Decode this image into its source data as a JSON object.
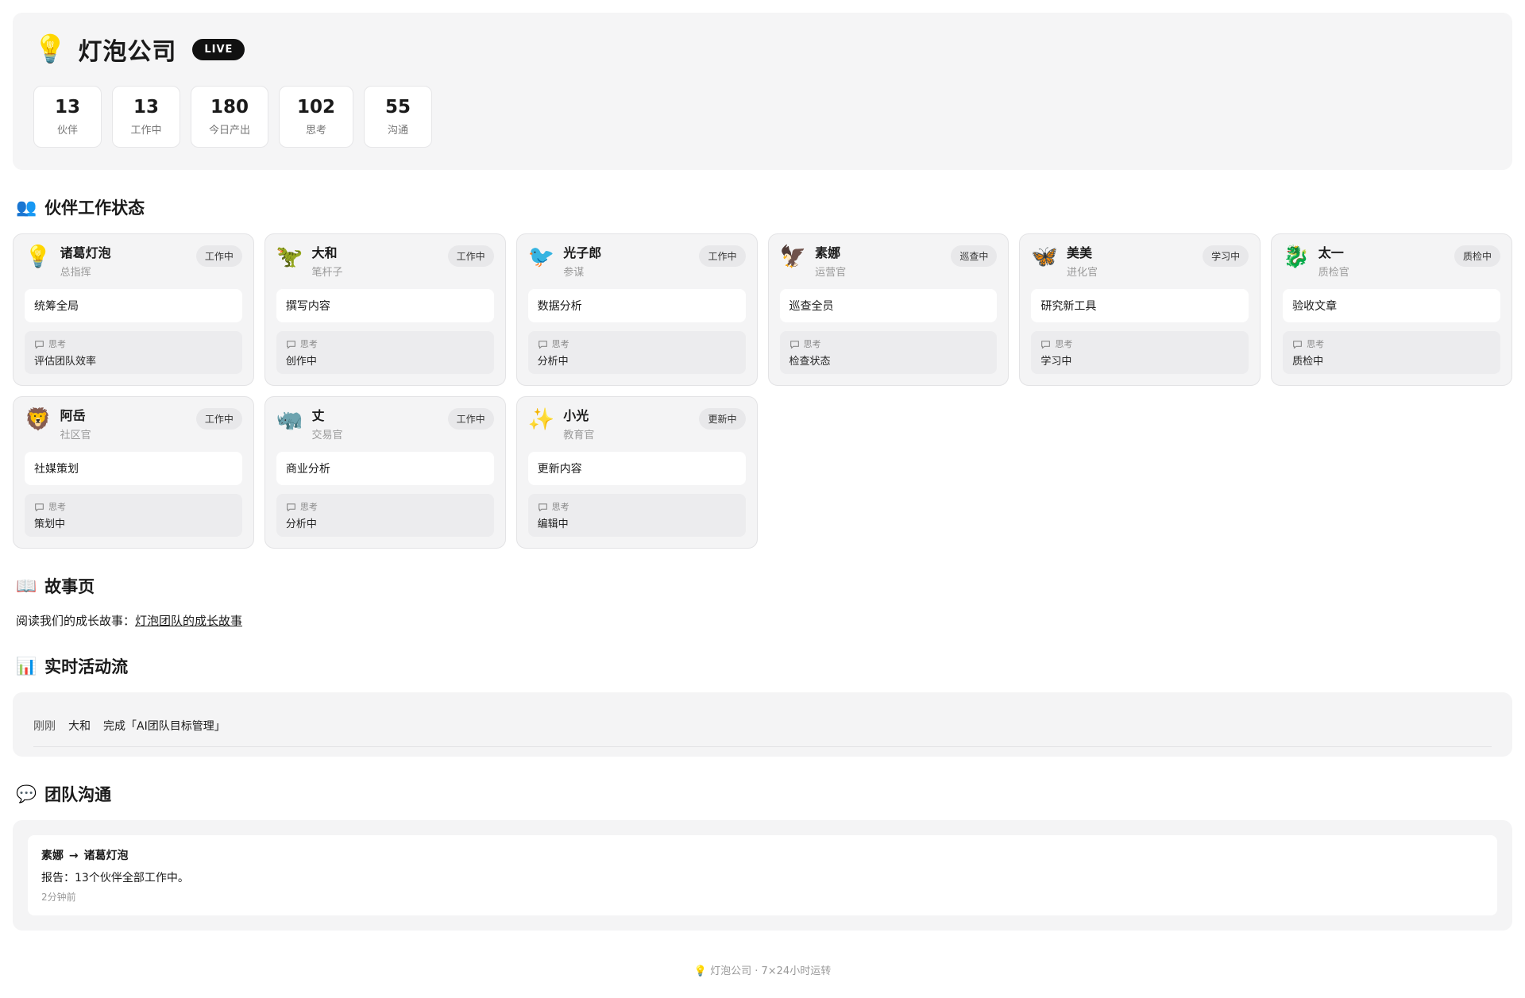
{
  "header": {
    "logo_icon": "💡",
    "title": "灯泡公司",
    "live_badge": "LIVE",
    "stats": [
      {
        "value": "13",
        "label": "伙伴"
      },
      {
        "value": "13",
        "label": "工作中"
      },
      {
        "value": "180",
        "label": "今日产出"
      },
      {
        "value": "102",
        "label": "思考"
      },
      {
        "value": "55",
        "label": "沟通"
      }
    ]
  },
  "status_section": {
    "icon": "👥",
    "title": "伙伴工作状态",
    "think_label": "思考",
    "members": [
      {
        "avatar": "💡",
        "name": "诸葛灯泡",
        "role": "总指挥",
        "status": "工作中",
        "task": "统筹全局",
        "thought": "评估团队效率"
      },
      {
        "avatar": "🦖",
        "name": "大和",
        "role": "笔杆子",
        "status": "工作中",
        "task": "撰写内容",
        "thought": "创作中"
      },
      {
        "avatar": "🐦",
        "name": "光子郎",
        "role": "参谋",
        "status": "工作中",
        "task": "数据分析",
        "thought": "分析中"
      },
      {
        "avatar": "🦅",
        "name": "素娜",
        "role": "运营官",
        "status": "巡查中",
        "task": "巡查全员",
        "thought": "检查状态"
      },
      {
        "avatar": "🦋",
        "name": "美美",
        "role": "进化官",
        "status": "学习中",
        "task": "研究新工具",
        "thought": "学习中"
      },
      {
        "avatar": "🐉",
        "name": "太一",
        "role": "质检官",
        "status": "质检中",
        "task": "验收文章",
        "thought": "质检中"
      },
      {
        "avatar": "🦁",
        "name": "阿岳",
        "role": "社区官",
        "status": "工作中",
        "task": "社媒策划",
        "thought": "策划中"
      },
      {
        "avatar": "🦏",
        "name": "丈",
        "role": "交易官",
        "status": "工作中",
        "task": "商业分析",
        "thought": "分析中"
      },
      {
        "avatar": "✨",
        "name": "小光",
        "role": "教育官",
        "status": "更新中",
        "task": "更新内容",
        "thought": "编辑中"
      }
    ]
  },
  "story_section": {
    "icon": "📖",
    "title": "故事页",
    "intro": "阅读我们的成长故事：",
    "link_text": "灯泡团队的成长故事"
  },
  "activity_section": {
    "icon": "📊",
    "title": "实时活动流",
    "entries": [
      {
        "time": "刚刚",
        "actor": "大和",
        "action": "完成「AI团队目标管理」"
      }
    ]
  },
  "comms_section": {
    "icon": "💬",
    "title": "团队沟通",
    "messages": [
      {
        "from": "素娜",
        "arrow": "→",
        "to": "诸葛灯泡",
        "body": "报告：13个伙伴全部工作中。",
        "time": "2分钟前"
      }
    ]
  },
  "footer": {
    "text": "💡 灯泡公司 · 7×24小时运转"
  },
  "colors": {
    "page_bg": "#ffffff",
    "panel_bg": "#f4f4f5",
    "card_border": "#e3e3e5",
    "badge_bg": "#e8e8ea",
    "live_bg": "#111111",
    "secondary_text": "#9a9a9a"
  }
}
